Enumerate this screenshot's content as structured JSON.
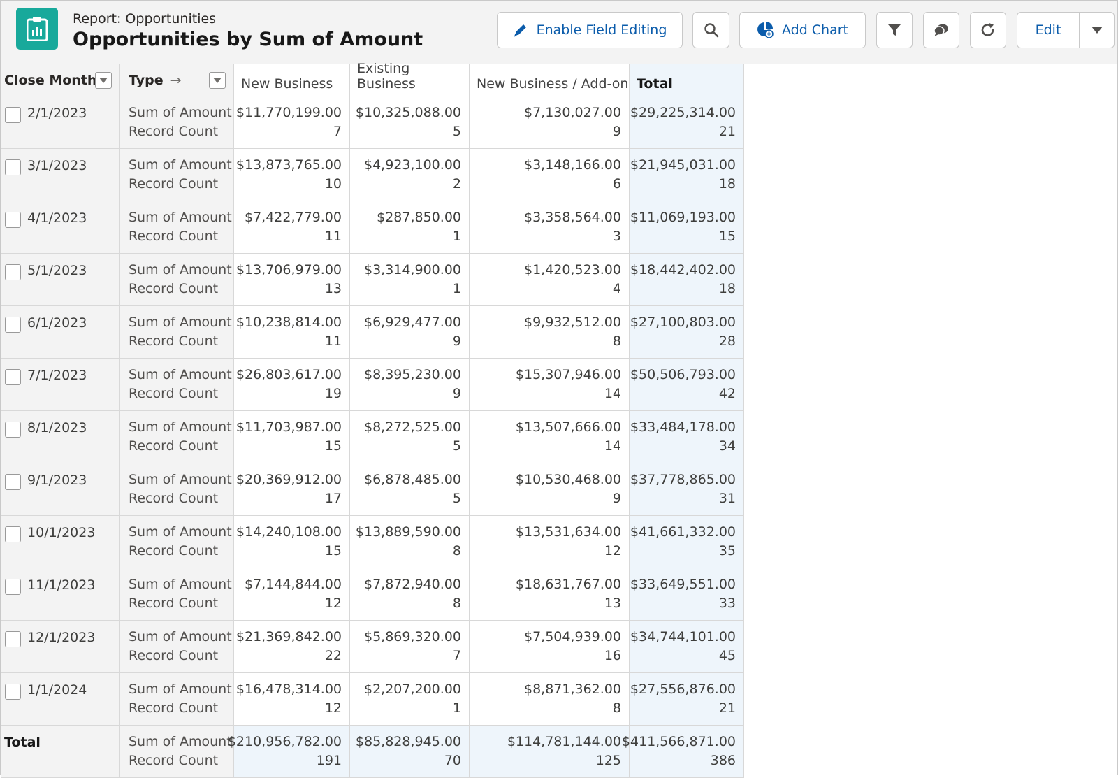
{
  "header": {
    "object_label": "Report: Opportunities",
    "title": "Opportunities by Sum of Amount",
    "enable_field_editing": "Enable Field Editing",
    "add_chart": "Add Chart",
    "edit": "Edit"
  },
  "columns": {
    "close_month": "Close Month",
    "type": "Type",
    "type_arrow": "→",
    "new_business": "New Business",
    "existing_business": "Existing Business",
    "new_business_addon": "New Business / Add-on",
    "total": "Total"
  },
  "measures": {
    "sum": "Sum of Amount",
    "count": "Record Count"
  },
  "rows": [
    {
      "month": "2/1/2023",
      "nb_amt": "$11,770,199.00",
      "nb_cnt": "7",
      "eb_amt": "$10,325,088.00",
      "eb_cnt": "5",
      "nba_amt": "$7,130,027.00",
      "nba_cnt": "9",
      "tot_amt": "$29,225,314.00",
      "tot_cnt": "21"
    },
    {
      "month": "3/1/2023",
      "nb_amt": "$13,873,765.00",
      "nb_cnt": "10",
      "eb_amt": "$4,923,100.00",
      "eb_cnt": "2",
      "nba_amt": "$3,148,166.00",
      "nba_cnt": "6",
      "tot_amt": "$21,945,031.00",
      "tot_cnt": "18"
    },
    {
      "month": "4/1/2023",
      "nb_amt": "$7,422,779.00",
      "nb_cnt": "11",
      "eb_amt": "$287,850.00",
      "eb_cnt": "1",
      "nba_amt": "$3,358,564.00",
      "nba_cnt": "3",
      "tot_amt": "$11,069,193.00",
      "tot_cnt": "15"
    },
    {
      "month": "5/1/2023",
      "nb_amt": "$13,706,979.00",
      "nb_cnt": "13",
      "eb_amt": "$3,314,900.00",
      "eb_cnt": "1",
      "nba_amt": "$1,420,523.00",
      "nba_cnt": "4",
      "tot_amt": "$18,442,402.00",
      "tot_cnt": "18"
    },
    {
      "month": "6/1/2023",
      "nb_amt": "$10,238,814.00",
      "nb_cnt": "11",
      "eb_amt": "$6,929,477.00",
      "eb_cnt": "9",
      "nba_amt": "$9,932,512.00",
      "nba_cnt": "8",
      "tot_amt": "$27,100,803.00",
      "tot_cnt": "28"
    },
    {
      "month": "7/1/2023",
      "nb_amt": "$26,803,617.00",
      "nb_cnt": "19",
      "eb_amt": "$8,395,230.00",
      "eb_cnt": "9",
      "nba_amt": "$15,307,946.00",
      "nba_cnt": "14",
      "tot_amt": "$50,506,793.00",
      "tot_cnt": "42"
    },
    {
      "month": "8/1/2023",
      "nb_amt": "$11,703,987.00",
      "nb_cnt": "15",
      "eb_amt": "$8,272,525.00",
      "eb_cnt": "5",
      "nba_amt": "$13,507,666.00",
      "nba_cnt": "14",
      "tot_amt": "$33,484,178.00",
      "tot_cnt": "34"
    },
    {
      "month": "9/1/2023",
      "nb_amt": "$20,369,912.00",
      "nb_cnt": "17",
      "eb_amt": "$6,878,485.00",
      "eb_cnt": "5",
      "nba_amt": "$10,530,468.00",
      "nba_cnt": "9",
      "tot_amt": "$37,778,865.00",
      "tot_cnt": "31"
    },
    {
      "month": "10/1/2023",
      "nb_amt": "$14,240,108.00",
      "nb_cnt": "15",
      "eb_amt": "$13,889,590.00",
      "eb_cnt": "8",
      "nba_amt": "$13,531,634.00",
      "nba_cnt": "12",
      "tot_amt": "$41,661,332.00",
      "tot_cnt": "35"
    },
    {
      "month": "11/1/2023",
      "nb_amt": "$7,144,844.00",
      "nb_cnt": "12",
      "eb_amt": "$7,872,940.00",
      "eb_cnt": "8",
      "nba_amt": "$18,631,767.00",
      "nba_cnt": "13",
      "tot_amt": "$33,649,551.00",
      "tot_cnt": "33"
    },
    {
      "month": "12/1/2023",
      "nb_amt": "$21,369,842.00",
      "nb_cnt": "22",
      "eb_amt": "$5,869,320.00",
      "eb_cnt": "7",
      "nba_amt": "$7,504,939.00",
      "nba_cnt": "16",
      "tot_amt": "$34,744,101.00",
      "tot_cnt": "45"
    },
    {
      "month": "1/1/2024",
      "nb_amt": "$16,478,314.00",
      "nb_cnt": "12",
      "eb_amt": "$2,207,200.00",
      "eb_cnt": "1",
      "nba_amt": "$8,871,362.00",
      "nba_cnt": "8",
      "tot_amt": "$27,556,876.00",
      "tot_cnt": "21"
    }
  ],
  "grand_total": {
    "label": "Total",
    "nb_amt": "$210,956,782.00",
    "nb_cnt": "191",
    "eb_amt": "$85,828,945.00",
    "eb_cnt": "70",
    "nba_amt": "$114,781,144.00",
    "nba_cnt": "125",
    "tot_amt": "$411,566,871.00",
    "tot_cnt": "386"
  },
  "colors": {
    "brand_icon": "#18a99b",
    "link_blue": "#0b5cab",
    "total_column_bg": "#eef5fb",
    "group_column_bg": "#f3f3f3"
  },
  "icons": [
    "report-icon",
    "pencil-icon",
    "search-icon",
    "add-chart-icon",
    "filter-icon",
    "chat-icon",
    "refresh-icon",
    "chevron-down-icon",
    "dropdown-icon",
    "arrow-right-icon",
    "checkbox"
  ]
}
